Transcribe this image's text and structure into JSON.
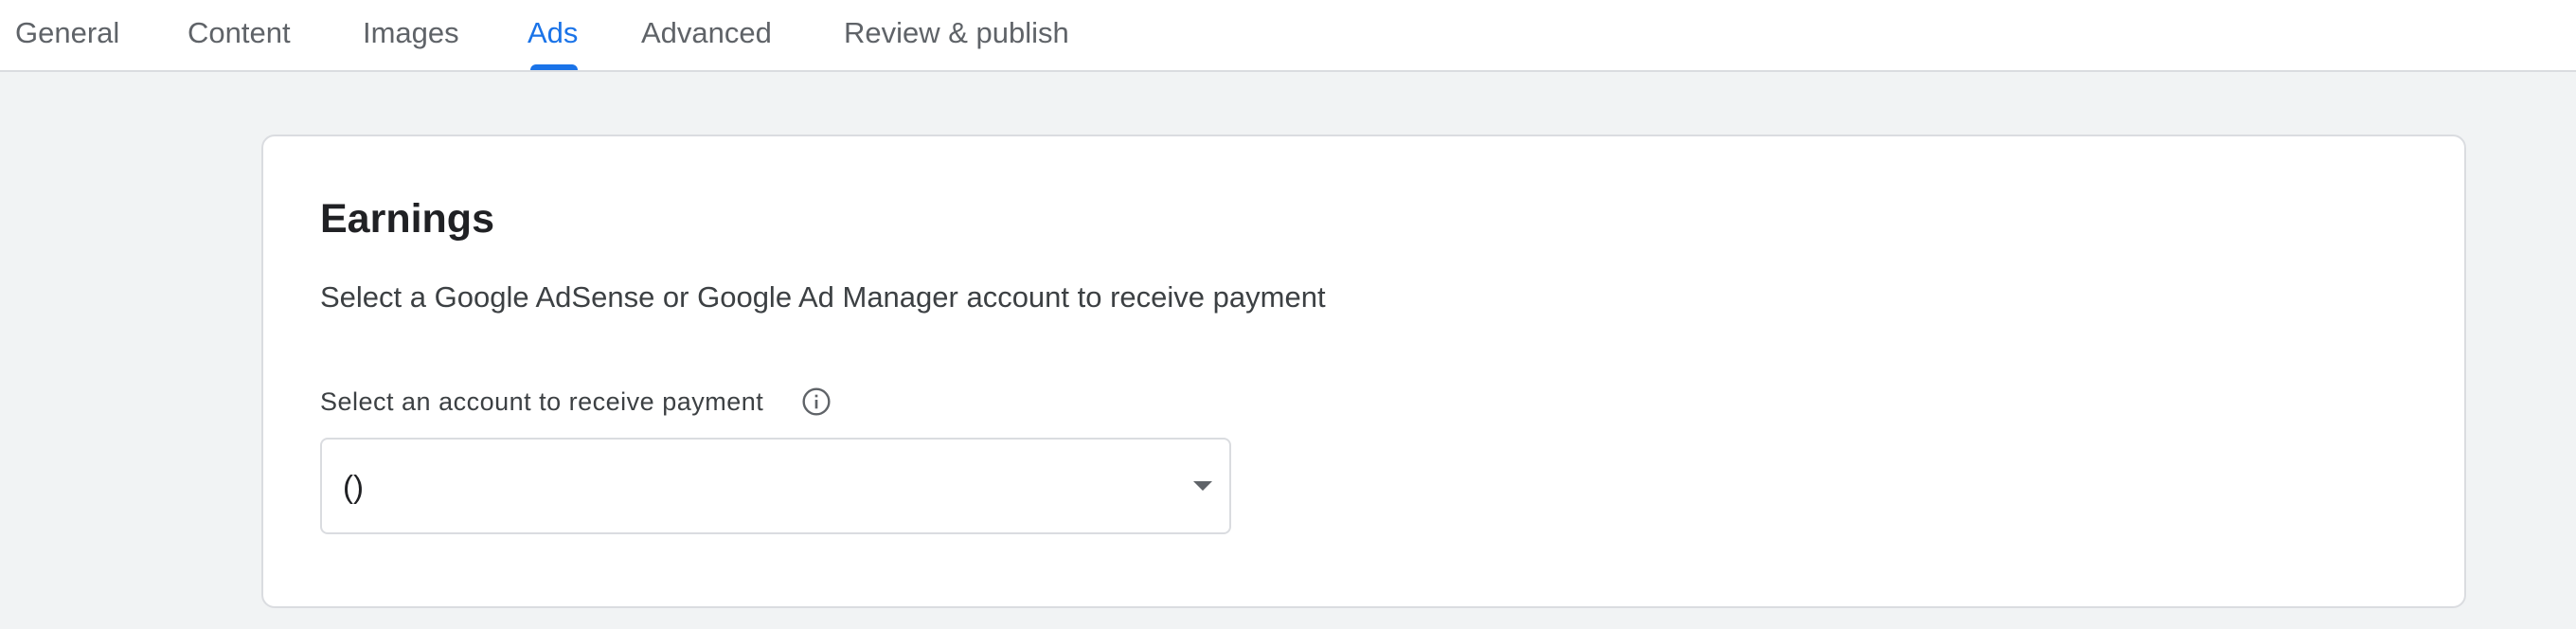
{
  "tabs": [
    {
      "label": "General",
      "active": false
    },
    {
      "label": "Content",
      "active": false
    },
    {
      "label": "Images",
      "active": false
    },
    {
      "label": "Ads",
      "active": true
    },
    {
      "label": "Advanced",
      "active": false
    },
    {
      "label": "Review & publish",
      "active": false
    }
  ],
  "earnings": {
    "title": "Earnings",
    "description": "Select a Google AdSense or Google Ad Manager account to receive payment",
    "field_label": "Select an account to receive payment",
    "selected_value": "()"
  },
  "icons": {
    "info": "info-icon",
    "dropdown": "arrow-drop-down-icon"
  },
  "colors": {
    "accent": "#1a73e8",
    "background": "#f1f3f4",
    "border": "#dadce0",
    "tab_text": "#5f6368",
    "text": "#202124"
  }
}
